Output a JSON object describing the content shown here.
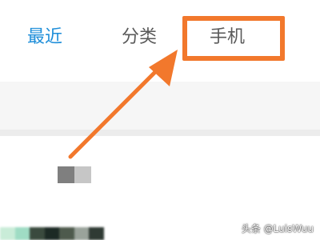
{
  "tabs": {
    "recent": {
      "label": "最近",
      "color": "#1e8ed9"
    },
    "category": {
      "label": "分类",
      "color": "#5a5a5a"
    },
    "phone": {
      "label": "手机",
      "color": "#5a5a5a"
    }
  },
  "annotation": {
    "color": "#f2782c",
    "target": "tab-phone",
    "highlight_stroke": 6,
    "arrow_stroke": 5
  },
  "bottom_strip_colors": [
    "#c9ecd8",
    "#9fdcc4",
    "#3a4a3e",
    "#1c2a25",
    "#4e5a4d",
    "#9aa39b",
    "#2f3a34"
  ],
  "watermark": {
    "text": "头条 @LuisWuu"
  }
}
